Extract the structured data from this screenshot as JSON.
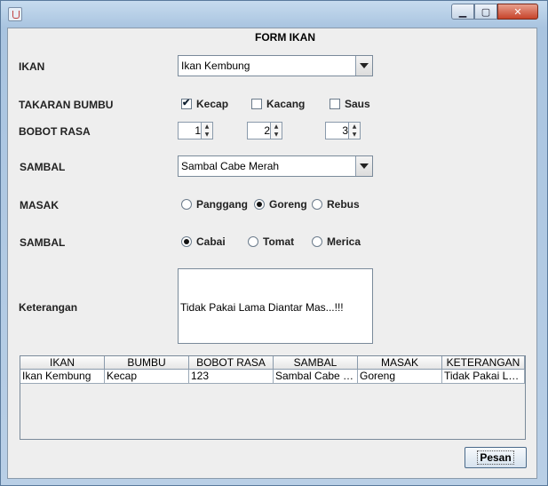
{
  "window": {
    "icons": {
      "app": "java-cup-icon",
      "minimize": "minimize-icon",
      "maximize": "maximize-icon",
      "close": "close-icon"
    }
  },
  "form": {
    "title": "FORM IKAN",
    "labels": {
      "ikan": "IKAN",
      "takaran": "TAKARAN BUMBU",
      "bobot": "BOBOT RASA",
      "sambal1": "SAMBAL",
      "masak": "MASAK",
      "sambal2": "SAMBAL",
      "keterangan": "Keterangan"
    },
    "ikan_combo": {
      "value": "Ikan Kembung"
    },
    "takaran": [
      {
        "label": "Kecap",
        "checked": true
      },
      {
        "label": "Kacang",
        "checked": false
      },
      {
        "label": "Saus",
        "checked": false
      }
    ],
    "bobot": [
      "1",
      "2",
      "3"
    ],
    "sambal_combo": {
      "value": "Sambal Cabe Merah"
    },
    "masak": [
      {
        "label": "Panggang",
        "checked": false
      },
      {
        "label": "Goreng",
        "checked": true
      },
      {
        "label": "Rebus",
        "checked": false
      }
    ],
    "sambal_radio": [
      {
        "label": "Cabai",
        "checked": true
      },
      {
        "label": "Tomat",
        "checked": false
      },
      {
        "label": "Merica",
        "checked": false
      }
    ],
    "keterangan_text": "Tidak Pakai Lama Diantar Mas...!!!"
  },
  "table": {
    "columns": [
      "IKAN",
      "BUMBU",
      "BOBOT RASA",
      "SAMBAL",
      "MASAK",
      "KETERANGAN"
    ],
    "rows": [
      [
        "Ikan Kembung",
        "Kecap",
        "123",
        "Sambal Cabe Merah",
        "Goreng",
        "Tidak Pakai Lama Diantar Mas...!!!"
      ]
    ]
  },
  "buttons": {
    "pesan": "Pesan"
  }
}
